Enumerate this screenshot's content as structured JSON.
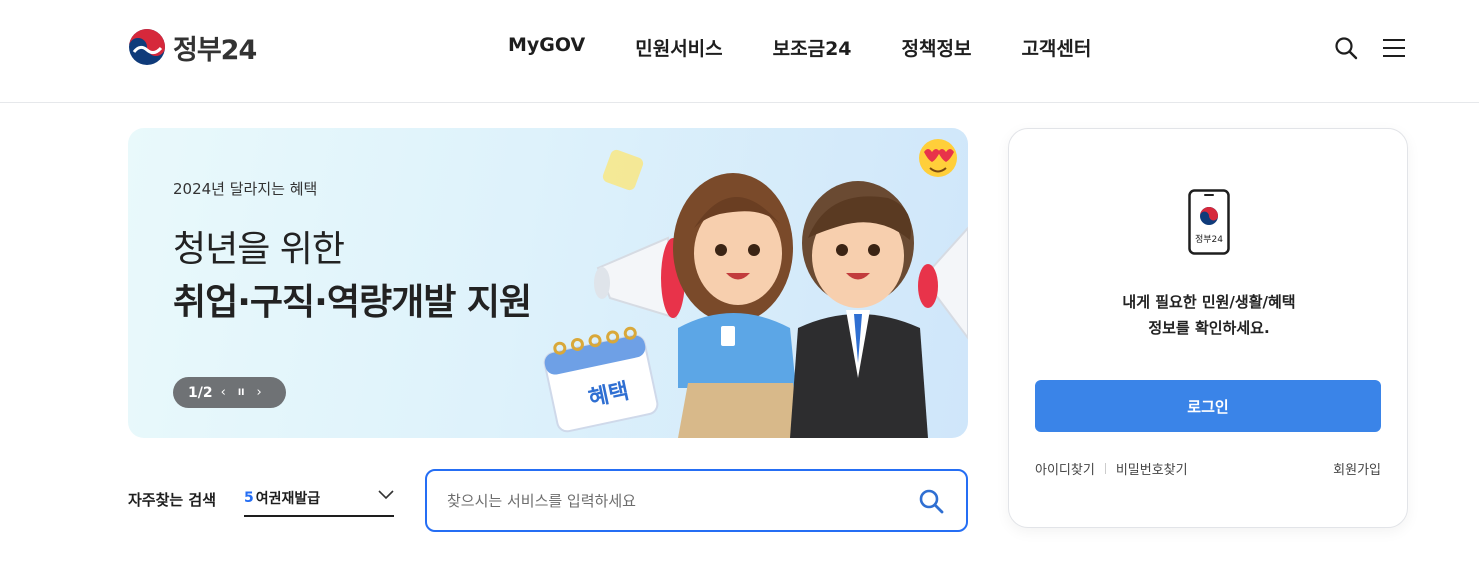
{
  "header": {
    "logo_text": "정부24",
    "nav": [
      "MyGOV",
      "민원서비스",
      "보조금24",
      "정책정보",
      "고객센터"
    ]
  },
  "banner": {
    "eyebrow": "2024년 달라지는 혜택",
    "title_line1": "청년을 위한",
    "title_line2": "취업·구직·역량개발 지원",
    "counter": "1/2",
    "prev": "‹",
    "pause": "II",
    "next": "›",
    "calendar_label": "혜택"
  },
  "quick_search": {
    "label": "자주찾는 검색",
    "selected_rank": "5",
    "selected_text": "여권재발급"
  },
  "search": {
    "placeholder": "찾으시는 서비스를 입력하세요",
    "value": ""
  },
  "login": {
    "phone_label": "정부24",
    "message_line1": "내게 필요한 민원/생활/혜택",
    "message_line2": "정보를 확인하세요.",
    "button": "로그인",
    "find_id": "아이디찾기",
    "find_pw": "비밀번호찾기",
    "signup": "회원가입"
  },
  "colors": {
    "accent": "#256ef4",
    "login_button": "#3a84e8",
    "banner_control": "#6f7275"
  }
}
